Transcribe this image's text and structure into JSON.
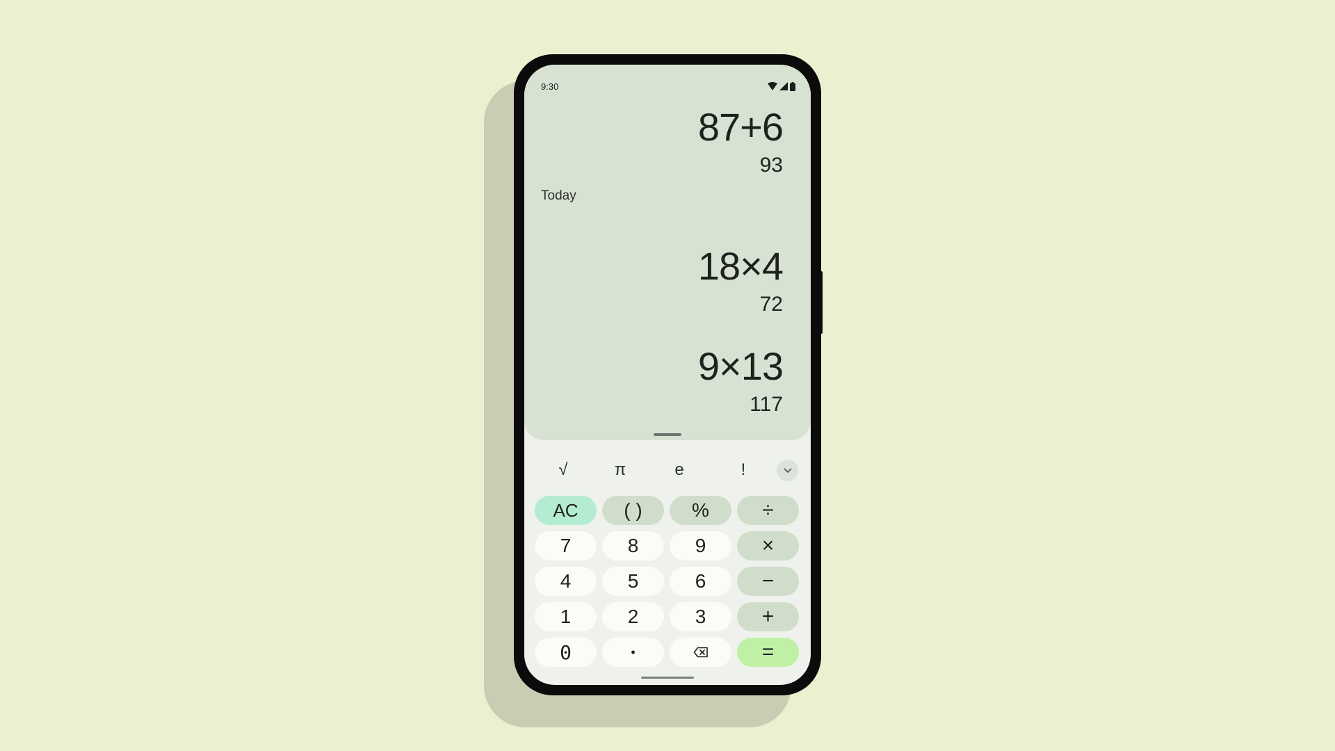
{
  "status_bar": {
    "time": "9:30"
  },
  "current": {
    "expression": "87+6",
    "result": "93"
  },
  "history": {
    "label": "Today",
    "entries": [
      {
        "expression": "18×4",
        "result": "72"
      },
      {
        "expression": "9×13",
        "result": "117"
      }
    ]
  },
  "scientific_row": [
    "√",
    "π",
    "e",
    "!"
  ],
  "keypad": {
    "ac": "AC",
    "parens": "( )",
    "percent": "%",
    "divide": "÷",
    "seven": "7",
    "eight": "8",
    "nine": "9",
    "multiply": "×",
    "four": "4",
    "five": "5",
    "six": "6",
    "minus": "−",
    "one": "1",
    "two": "2",
    "three": "3",
    "plus": "+",
    "zero": "0",
    "decimal": "•",
    "equals": "="
  },
  "colors": {
    "background": "#ebf0d0",
    "display": "#d8e2d3",
    "ac_key": "#b4ecd1",
    "equals_key": "#bff0a6",
    "function_key": "#d1ddcb"
  },
  "icons": [
    "wifi-icon",
    "cellular-icon",
    "battery-icon",
    "chevron-down-icon",
    "backspace-icon"
  ]
}
